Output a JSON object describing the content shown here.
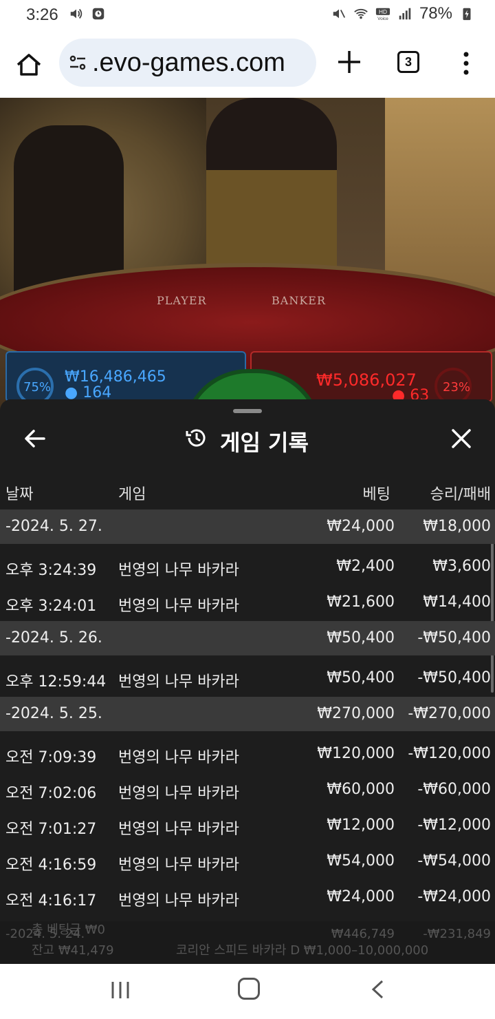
{
  "status_bar": {
    "time": "3:26",
    "battery": "78%"
  },
  "browser": {
    "url": ".evo-games.com",
    "tab_count": "3"
  },
  "video": {
    "player_label": "PLAYER",
    "banker_label": "BANKER",
    "player_pct": "75%",
    "player_amount": "₩16,486,465",
    "player_count": "164",
    "banker_amount": "₩5,086,027",
    "banker_count": "63",
    "banker_pct": "23%"
  },
  "history": {
    "title": "게임 기록",
    "columns": {
      "date": "날짜",
      "game": "게임",
      "bet": "베팅",
      "winloss": "승리/패배"
    },
    "groups": [
      {
        "date": "-2024. 5. 27.",
        "bet": "₩24,000",
        "winloss": "₩18,000",
        "rows": [
          {
            "time": "오후 3:24:39",
            "game": "번영의 나무 바카라",
            "bet": "₩2,400",
            "winloss": "₩3,600"
          },
          {
            "time": "오후 3:24:01",
            "game": "번영의 나무 바카라",
            "bet": "₩21,600",
            "winloss": "₩14,400"
          }
        ]
      },
      {
        "date": "-2024. 5. 26.",
        "bet": "₩50,400",
        "winloss": "-₩50,400",
        "rows": [
          {
            "time": "오후 12:59:44",
            "game": "번영의 나무 바카라",
            "bet": "₩50,400",
            "winloss": "-₩50,400"
          }
        ]
      },
      {
        "date": "-2024. 5. 25.",
        "bet": "₩270,000",
        "winloss": "-₩270,000",
        "rows": [
          {
            "time": "오전 7:09:39",
            "game": "번영의 나무 바카라",
            "bet": "₩120,000",
            "winloss": "-₩120,000"
          },
          {
            "time": "오전 7:02:06",
            "game": "번영의 나무 바카라",
            "bet": "₩60,000",
            "winloss": "-₩60,000"
          },
          {
            "time": "오전 7:01:27",
            "game": "번영의 나무 바카라",
            "bet": "₩12,000",
            "winloss": "-₩12,000"
          },
          {
            "time": "오전 4:16:59",
            "game": "번영의 나무 바카라",
            "bet": "₩54,000",
            "winloss": "-₩54,000"
          },
          {
            "time": "오전 4:16:17",
            "game": "번영의 나무 바카라",
            "bet": "₩24,000",
            "winloss": "-₩24,000"
          }
        ]
      }
    ],
    "partial_group": {
      "date": "-2024. 5. 24.",
      "bet": "₩446,749",
      "winloss": "-₩231,849"
    }
  },
  "footer_overlay": {
    "total_bet": "총 베팅금 ₩0",
    "balance": "잔고 ₩41,479",
    "table_info": "코리안 스피드 바카라 D ₩1,000–10,000,000"
  },
  "colors": {
    "player_blue": "#49a7ff",
    "banker_red": "#ff2a2a",
    "sheet_bg": "#1d1d1d",
    "date_row_bg": "#3a3a3a"
  }
}
